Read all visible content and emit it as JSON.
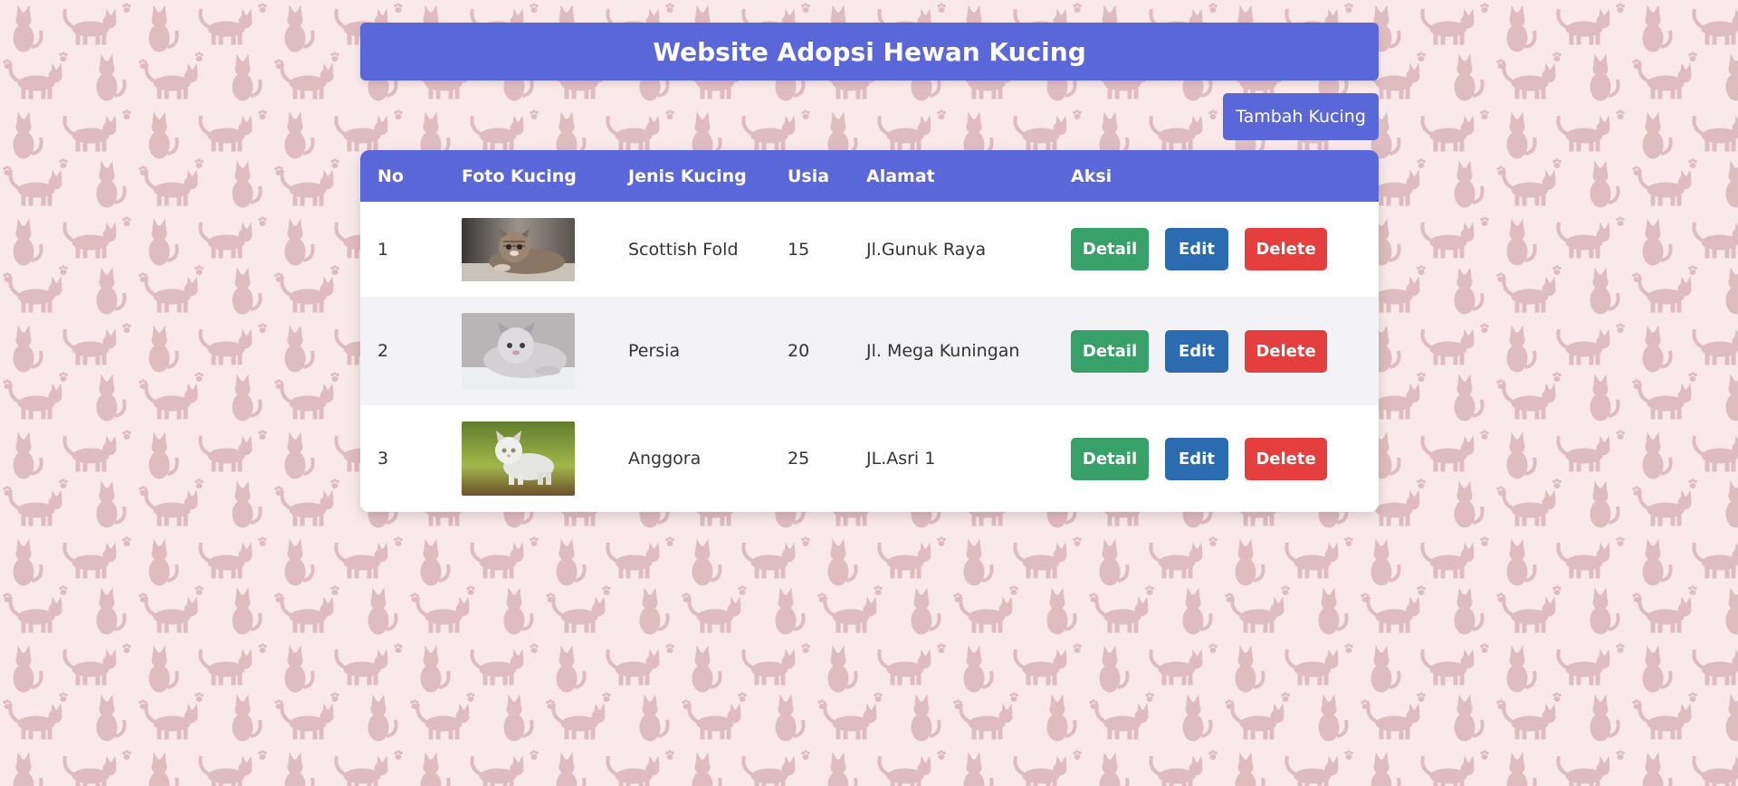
{
  "app": {
    "title": "Website Adopsi Hewan Kucing",
    "add_button_label": "Tambah Kucing"
  },
  "colors": {
    "primary": "#5a67d8",
    "detail": "#38a169",
    "edit": "#2b6cb0",
    "delete": "#e53e3e",
    "background": "#f9e9ea",
    "pattern": "#dfbcc0"
  },
  "table": {
    "headers": {
      "no": "No",
      "foto": "Foto Kucing",
      "jenis": "Jenis Kucing",
      "usia": "Usia",
      "alamat": "Alamat",
      "aksi": "Aksi"
    },
    "action_labels": {
      "detail": "Detail",
      "edit": "Edit",
      "delete": "Delete"
    },
    "rows": [
      {
        "no": "1",
        "jenis": "Scottish Fold",
        "usia": "15",
        "alamat": "Jl.Gunuk Raya",
        "photo_icon": "tabby-cat-photo"
      },
      {
        "no": "2",
        "jenis": "Persia",
        "usia": "20",
        "alamat": "Jl. Mega Kuningan",
        "photo_icon": "grey-persian-cat-photo"
      },
      {
        "no": "3",
        "jenis": "Anggora",
        "usia": "25",
        "alamat": "JL.Asri 1",
        "photo_icon": "white-cat-on-grass-photo"
      }
    ]
  }
}
